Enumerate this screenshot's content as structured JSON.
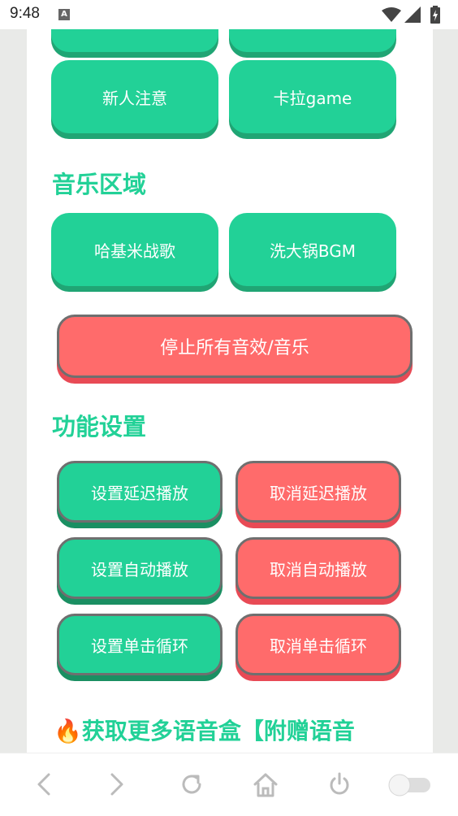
{
  "status_bar": {
    "time": "9:48",
    "notification_icon": "A",
    "icons": [
      "wifi-icon",
      "signal-icon",
      "battery-charging-icon"
    ]
  },
  "partial_buttons": {
    "left_label": "",
    "right_label": ""
  },
  "top_buttons": [
    {
      "label": "新人注意"
    },
    {
      "label": "卡拉game"
    }
  ],
  "music_section": {
    "title": "音乐区域",
    "buttons": [
      {
        "label": "哈基米战歌"
      },
      {
        "label": "洗大锅BGM"
      }
    ],
    "stop_all_label": "停止所有音效/音乐"
  },
  "function_section": {
    "title": "功能设置",
    "rows": [
      {
        "set_label": "设置延迟播放",
        "cancel_label": "取消延迟播放"
      },
      {
        "set_label": "设置自动播放",
        "cancel_label": "取消自动播放"
      },
      {
        "set_label": "设置单击循环",
        "cancel_label": "取消单击循环"
      }
    ]
  },
  "more_section": {
    "title": "🔥获取更多语音盒【附赠语音"
  },
  "nav_bar": {
    "icons": [
      "back-icon",
      "forward-icon",
      "refresh-icon",
      "home-icon",
      "power-icon",
      "toggle-icon"
    ]
  },
  "colors": {
    "green": "#22d197",
    "green_shadow": "#20a574",
    "red": "#ff6b6b",
    "red_shadow": "#f04e5a",
    "page_bg": "#e9eae8"
  }
}
